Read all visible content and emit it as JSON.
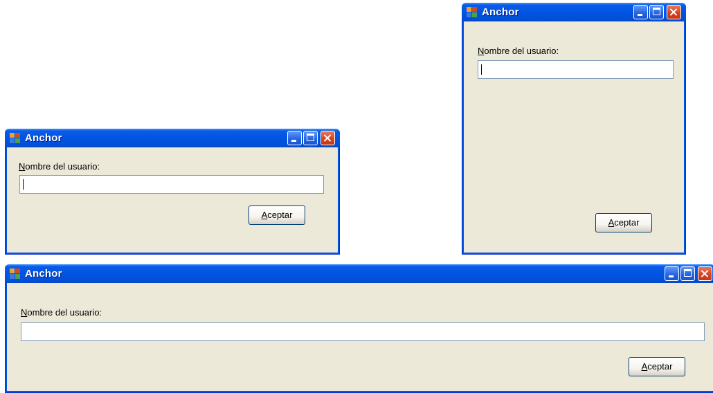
{
  "window_title": "Anchor",
  "label_text": "Nombre del usuario:",
  "textbox_value": "",
  "button_label": "Aceptar",
  "colors": {
    "titlebar": "#0054e3",
    "client": "#ece9d8",
    "close": "#d4401f",
    "textbox_border": "#7f9db9"
  },
  "icons": [
    "app-icon",
    "minimize-icon",
    "maximize-icon",
    "close-icon"
  ]
}
